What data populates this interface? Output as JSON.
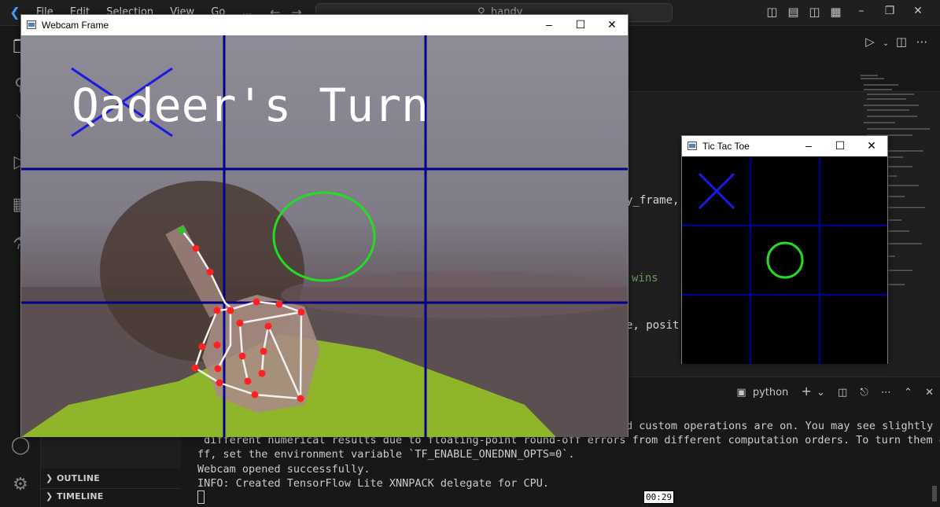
{
  "vscode": {
    "menu": [
      "File",
      "Edit",
      "Selection",
      "View",
      "Go",
      "…"
    ],
    "search_text": "handy",
    "code_fragments": {
      "line1": "y_frame,",
      "line2": "wins",
      "line3": "e, posit"
    },
    "sidebar": {
      "outline_label": "OUTLINE",
      "timeline_label": "TIMELINE"
    },
    "terminal": {
      "shell_label": "python",
      "lines": [
        "d custom operations are on. You may see slightly",
        " different numerical results due to floating-point round-off errors from different computation orders. To turn them o",
        "ff, set the environment variable `TF_ENABLE_ONEDNN_OPTS=0`.",
        "Webcam opened successfully.",
        "INFO: Created TensorFlow Lite XNNPACK delegate for CPU."
      ]
    },
    "time_badge": "00:29"
  },
  "webcam_window": {
    "title": "Webcam Frame",
    "overlay_text": "Qadeer's Turn",
    "colors": {
      "grid": "#00008b",
      "o_mark": "#22dd22",
      "x_mark": "#1a1ae0",
      "landmark": "#ff2020",
      "tip": "#22cc22"
    }
  },
  "ttt_window": {
    "title": "Tic Tac Toe",
    "board": [
      "X",
      "",
      "",
      "",
      "O",
      "",
      "",
      "",
      ""
    ]
  },
  "icons": {
    "minimize": "minimize-icon",
    "maximize": "maximize-icon",
    "close": "close-icon"
  }
}
